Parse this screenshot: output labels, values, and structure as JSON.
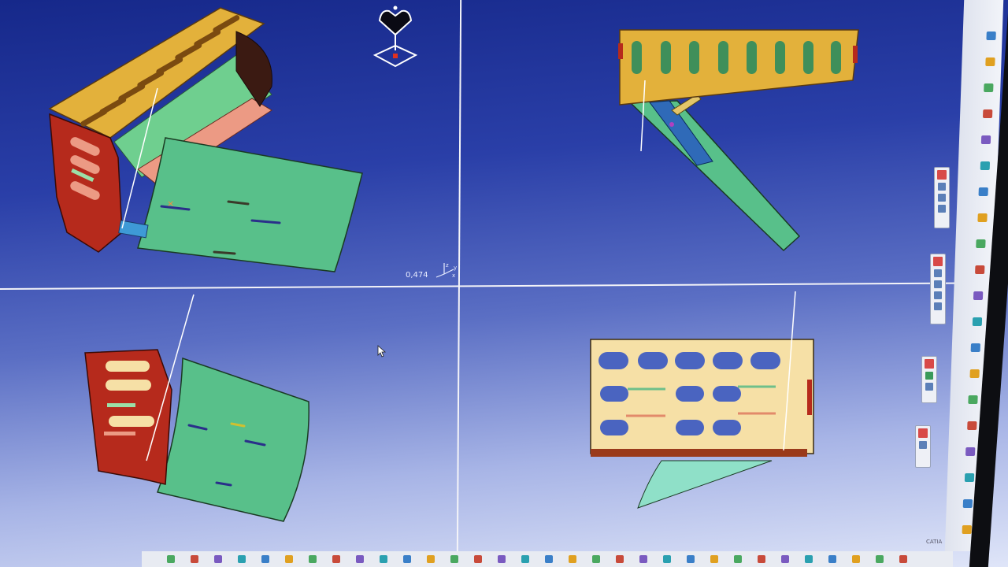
{
  "viewport": {
    "scale_label": "0,474",
    "axis_labels": {
      "x": "x",
      "y": "y",
      "z": "z"
    }
  },
  "compass": {
    "icon": "compass-icon"
  },
  "brand": {
    "label": "CATIA"
  },
  "colors": {
    "background_top": "#16288a",
    "background_bottom": "#dfe5f8",
    "panel_yellow": "#e3b13b",
    "panel_red": "#b62a1c",
    "panel_green": "#58c08a",
    "panel_salmon": "#ec9a84",
    "panel_light": "#f6e0a6",
    "selection": "#ffffff"
  },
  "right_toolbar": {
    "icons": [
      "sketch-icon",
      "pad-icon",
      "pocket-icon",
      "shaft-icon",
      "groove-icon",
      "hole-icon",
      "rib-icon",
      "slot-icon",
      "fillet-icon",
      "chamfer-icon",
      "draft-icon",
      "shell-icon",
      "thickness-icon",
      "thread-icon",
      "mirror-icon",
      "pattern-icon",
      "scale-icon",
      "boolean-icon",
      "measure-icon",
      "analysis-icon"
    ]
  },
  "floating_palettes": [
    {
      "name": "sketch-tools-palette",
      "icons": [
        "point-icon",
        "line-icon",
        "rectangle-icon"
      ]
    },
    {
      "name": "constraint-palette",
      "icons": [
        "constraint-icon",
        "contact-icon",
        "fix-icon",
        "anchor-icon"
      ]
    },
    {
      "name": "view-palette",
      "icons": [
        "render-icon",
        "save-icon"
      ]
    },
    {
      "name": "tools-palette",
      "icons": [
        "table-icon"
      ]
    }
  ],
  "bottom_toolbar": {
    "icons": [
      "select-icon",
      "undo-icon",
      "redo-icon",
      "pan-icon",
      "rotate-icon",
      "zoom-in-icon",
      "zoom-out-icon",
      "fit-all-icon",
      "normal-view-icon",
      "multi-view-icon",
      "iso-view-icon",
      "shading-icon",
      "hide-show-icon",
      "swap-icon",
      "update-icon",
      "snap-icon",
      "grid-icon",
      "constraints-icon",
      "dimension-icon",
      "analysis-icon",
      "measure-icon",
      "catalog-icon",
      "material-icon",
      "render-icon",
      "light-icon",
      "camera-icon",
      "section-icon",
      "clash-icon",
      "annotation-icon",
      "publish-icon",
      "compass-icon",
      "properties-icon"
    ]
  }
}
